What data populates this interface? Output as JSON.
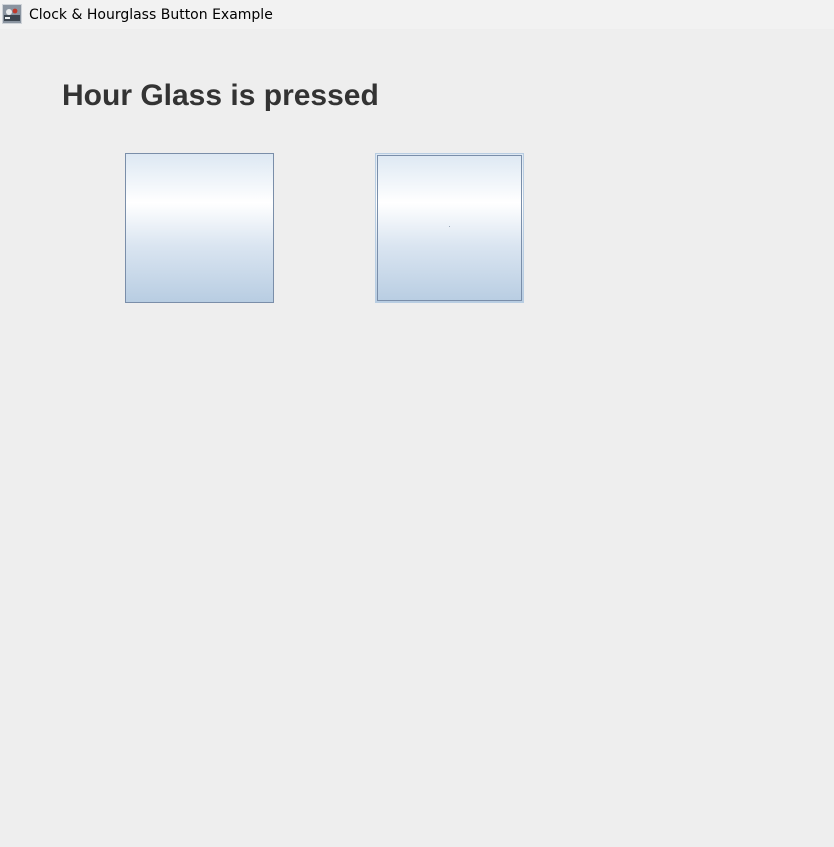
{
  "window": {
    "title": "Clock & Hourglass Button Example",
    "icon": "java-app-icon"
  },
  "main": {
    "status_label": "Hour Glass is pressed",
    "buttons": [
      {
        "name": "clock",
        "icon": "clock-icon",
        "pressed": false
      },
      {
        "name": "hourglass",
        "icon": "hourglass-icon",
        "pressed": true,
        "focused": true
      }
    ]
  },
  "colors": {
    "background": "#eeeeee",
    "titlebar": "#f2f2f2",
    "label_text": "#333333",
    "button_border": "#7a8ea9",
    "button_gradient_top": "#ffffff",
    "button_gradient_bottom": "#b8cde2"
  }
}
